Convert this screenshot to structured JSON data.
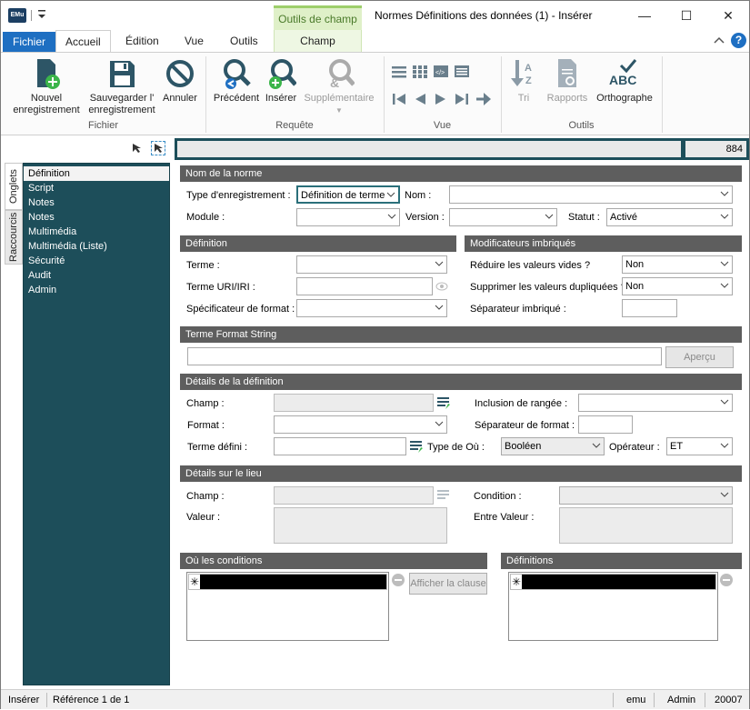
{
  "window": {
    "title": "Normes Définitions des données (1) - Insérer",
    "logo": "EMu",
    "context_tool_header": "Outils de champ",
    "context_tab": "Champ",
    "minimize": "—",
    "maximize": "☐",
    "close": "✕"
  },
  "tabs": [
    "Fichier",
    "Accueil",
    "Édition",
    "Vue",
    "Outils"
  ],
  "ribbon": {
    "buttons": {
      "new_line1": "Nouvel",
      "new_line2": "enregistrement",
      "save_line1": "Sauvegarder l'",
      "save_line2": "enregistrement",
      "cancel": "Annuler",
      "previous": "Précédent",
      "insert": "Insérer",
      "supplementary": "Supplémentaire",
      "sort": "Tri",
      "reports": "Rapports",
      "spelling": "Orthographe",
      "spelling_icon": "ABC"
    },
    "groups": {
      "file": "Fichier",
      "query": "Requête",
      "view": "Vue",
      "tools": "Outils"
    }
  },
  "side_tabs": [
    "Onglets",
    "Raccourcis"
  ],
  "nav_items": [
    "Définition",
    "Script",
    "Notes",
    "Notes",
    "Multimédia",
    "Multimédia (Liste)",
    "Sécurité",
    "Audit",
    "Admin"
  ],
  "record": {
    "number": "884"
  },
  "sections": {
    "norm_name": {
      "title": "Nom de la norme",
      "record_type_label": "Type d'enregistrement :",
      "record_type_value": "Définition de terme",
      "name_label": "Nom :",
      "module_label": "Module :",
      "version_label": "Version :",
      "status_label": "Statut :",
      "status_value": "Activé"
    },
    "definition": {
      "title": "Définition",
      "term_label": "Terme :",
      "uri_label": "Terme URI/IRI :",
      "format_spec_label": "Spécificateur de format :"
    },
    "nested": {
      "title": "Modificateurs imbriqués",
      "reduce_empty_label": "Réduire les valeurs vides ?",
      "reduce_empty_value": "Non",
      "remove_dup_label": "Supprimer les valeurs dupliquées ?",
      "remove_dup_value": "Non",
      "separator_label": "Séparateur imbriqué :"
    },
    "term_format": {
      "title": "Terme Format String",
      "preview_button": "Aperçu"
    },
    "def_details": {
      "title": "Détails de la définition",
      "field_label": "Champ :",
      "format_label": "Format :",
      "defined_term_label": "Terme défini :",
      "where_type_label": "Type de Où :",
      "where_type_value": "Booléen",
      "operator_label": "Opérateur :",
      "operator_value": "ET",
      "row_inclusion_label": "Inclusion de rangée :",
      "format_sep_label": "Séparateur de format :"
    },
    "place_details": {
      "title": "Détails sur le lieu",
      "field_label": "Champ :",
      "value_label": "Valeur :",
      "condition_label": "Condition :",
      "between_label": "Entre Valeur :"
    },
    "where_conditions": {
      "title": "Où les conditions",
      "show_clause_button": "Afficher la clause",
      "row_marker": "✳"
    },
    "definitions": {
      "title": "Définitions",
      "row_marker": "✳"
    }
  },
  "status_bar": {
    "mode": "Insérer",
    "reference": "Référence 1 de 1",
    "user": "emu",
    "group": "Admin",
    "year": "20007"
  },
  "colors": {
    "accent_blue": "#1e6fc2",
    "nav_teal": "#1d4e5a",
    "section_gray": "#5e5e5e",
    "context_green": "#9ecf6b",
    "add_green": "#3bb54a"
  }
}
